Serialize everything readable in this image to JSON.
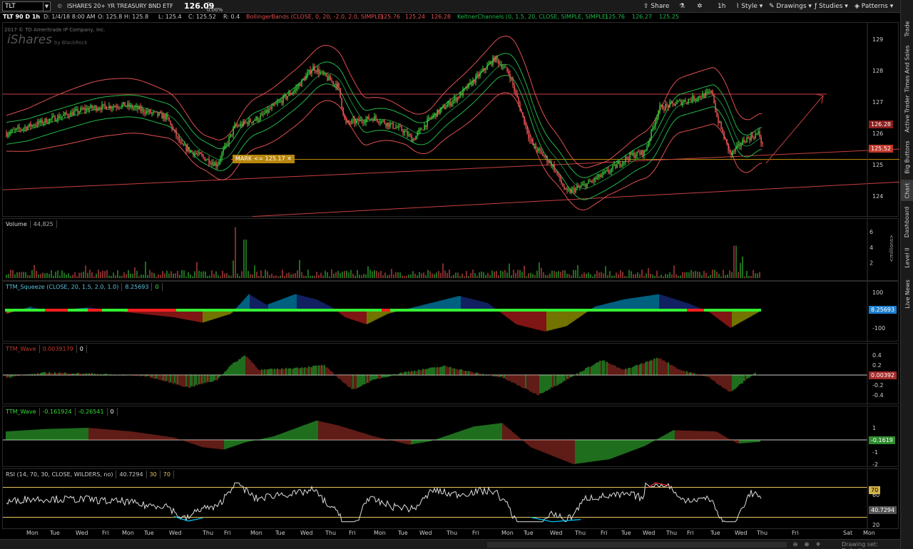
{
  "toolbar": {
    "symbol": "TLT",
    "description": "ISHARES 20+ YR TREASURY BND ETF",
    "last": "126.09",
    "change": "0",
    "change_pct": "0.00%",
    "buttons": {
      "share": "Share",
      "interval": "1h",
      "style": "Style",
      "drawings": "Drawings",
      "studies": "Studies",
      "patterns": "Patterns"
    }
  },
  "info": {
    "study_label": "TLT 90 D 1h",
    "date": "D: 1/4/18 8:00 AM",
    "open": "O: 125.8",
    "high": "H: 125.8",
    "low": "L: 125.4",
    "close": "C: 125.52",
    "range": "R: 0.4",
    "bb_label": "BollingerBands (CLOSE, 0, 20, -2.0, 2.0, SIMPLE)",
    "bb_values": [
      "125.76",
      "125.24",
      "126.28"
    ],
    "kc_label": "KeltnerChannels (0, 1.5, 20, CLOSE, SIMPLE, SIMPLE)",
    "kc_values": [
      "125.76",
      "126.27",
      "125.25"
    ]
  },
  "watermark": {
    "copyright": "2017 © TD Ameritrade IP Company, Inc.",
    "brand": "iShares",
    "brand_sub": "by BlackRock"
  },
  "price_chart": {
    "y_ticks": [
      "129",
      "128",
      "127",
      "126",
      "125",
      "124"
    ],
    "price_boxes": {
      "upper": "126.28",
      "last": "125.52"
    },
    "mark_label": "MARK <= 125.17"
  },
  "volume": {
    "label": "Volume",
    "value": "44,825",
    "y_ticks": [
      "6",
      "4",
      "2"
    ],
    "unit": "<millions>"
  },
  "squeeze": {
    "label": "TTM_Squeeze (CLOSE, 20, 1.5, 2.0, 1.0)",
    "value": "8.25693",
    "zero": "0",
    "y_ticks": [
      "100",
      "-100"
    ],
    "box": "8.25693"
  },
  "wave1": {
    "label": "TTM_Wave",
    "value": "0.0039179",
    "zero": "0",
    "y_ticks": [
      "0.4",
      "0.2",
      "-0.2",
      "-0.4"
    ],
    "box": "0.00392"
  },
  "wave2": {
    "label": "TTM_Wave",
    "v1": "-0.161924",
    "v2": "-0.26541",
    "zero": "0",
    "y_ticks": [
      "1",
      "-1",
      "-2"
    ],
    "box": "-0.1619"
  },
  "rsi": {
    "label": "RSI (14, 70, 30, CLOSE, WILDERS, no)",
    "value": "40.7294",
    "lower": "30",
    "upper": "70",
    "y_ticks": [
      "60",
      "20"
    ],
    "box_upper": "70",
    "box_value": "40.7294"
  },
  "time_axis": [
    "Mon",
    "Tue",
    "Wed",
    "Fri",
    "Mon",
    "Tue",
    "Wed",
    "Thu",
    "Fri",
    "Mon",
    "Tue",
    "Wed",
    "Thu",
    "Fri",
    "Mon",
    "Tue",
    "Wed",
    "Thu",
    "Fri",
    "Mon",
    "Tue",
    "Wed",
    "Thu",
    "Fri",
    "Tue",
    "Wed",
    "Thu",
    "Fri",
    "Tue",
    "Wed",
    "Thu",
    "Fri",
    "Sat",
    "Mon"
  ],
  "side_tabs": [
    "Trade",
    "Times And Sales",
    "Active Trader",
    "Big Buttons",
    "Chart",
    "Dashboard",
    "Level II",
    "Live News"
  ],
  "status": {
    "drawing_set": "Drawing set: Default"
  },
  "colors": {
    "up": "#3ddc3d",
    "down": "#ff5a5a",
    "band": "#e05050",
    "keltner": "#22b84a",
    "squeeze_on": "#ff2020",
    "squeeze_off": "#33ee33"
  }
}
